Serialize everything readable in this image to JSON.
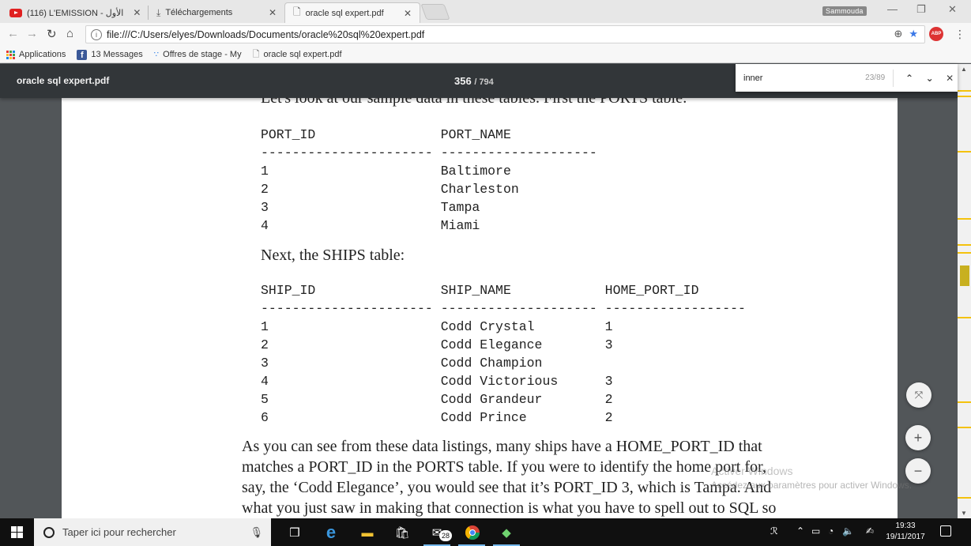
{
  "browser": {
    "tabs": [
      {
        "label": "(116) L'EMISSION - الأول",
        "icon": "youtube-icon",
        "active": false
      },
      {
        "label": "Téléchargements",
        "icon": "download-icon",
        "active": false
      },
      {
        "label": "oracle sql expert.pdf",
        "icon": "document-icon",
        "active": true
      }
    ],
    "user_badge": "Sammouda",
    "url": "file:///C:/Users/elyes/Downloads/Documents/oracle%20sql%20expert.pdf",
    "abp_label": "ABP",
    "accent_color": "#3b78e7"
  },
  "bookmarks": [
    {
      "label": "Applications",
      "icon": "apps-grid-icon"
    },
    {
      "label": "13 Messages",
      "icon": "facebook-icon"
    },
    {
      "label": "Offres de stage - My",
      "icon": "link-icon"
    },
    {
      "label": "oracle sql expert.pdf",
      "icon": "document-icon"
    }
  ],
  "pdf": {
    "title": "oracle sql expert.pdf",
    "current_page": "356",
    "total_pages": "/ 794",
    "find": {
      "query": "inner",
      "count": "23/89"
    },
    "content": {
      "intro_partial": "Let's look at our sample data in these tables. First the PORTS table:",
      "ports_header": "PORT_ID                PORT_NAME",
      "ports_rule": "---------------------- --------------------",
      "ports_rows": [
        "1                      Baltimore",
        "2                      Charleston",
        "3                      Tampa",
        "4                      Miami"
      ],
      "ships_intro": "Next, the SHIPS table:",
      "ships_header": "SHIP_ID                SHIP_NAME            HOME_PORT_ID",
      "ships_rule": "---------------------- -------------------- ------------------",
      "ships_rows": [
        "1                      Codd Crystal         1",
        "2                      Codd Elegance        3",
        "3                      Codd Champion",
        "4                      Codd Victorious      3",
        "5                      Codd Grandeur        2",
        "6                      Codd Prince          2"
      ],
      "paragraph": [
        "    As you can see from these data listings, many ships have a HOME_PORT_ID that",
        "matches a PORT_ID in the PORTS table. If you were to identify the home port for,",
        "say, the ‘Codd Elegance’, you would see that it’s PORT_ID 3, which is Tampa. And",
        "what you just saw in making that connection is what you have to spell out to SQL so"
      ]
    }
  },
  "watermark": {
    "line1": "Activer Windows",
    "line2": "Accédez aux paramètres pour activer Windows."
  },
  "taskbar": {
    "search_placeholder": "Taper ici pour rechercher",
    "mail_badge": "28",
    "time": "19:33",
    "date": "19/11/2017"
  }
}
